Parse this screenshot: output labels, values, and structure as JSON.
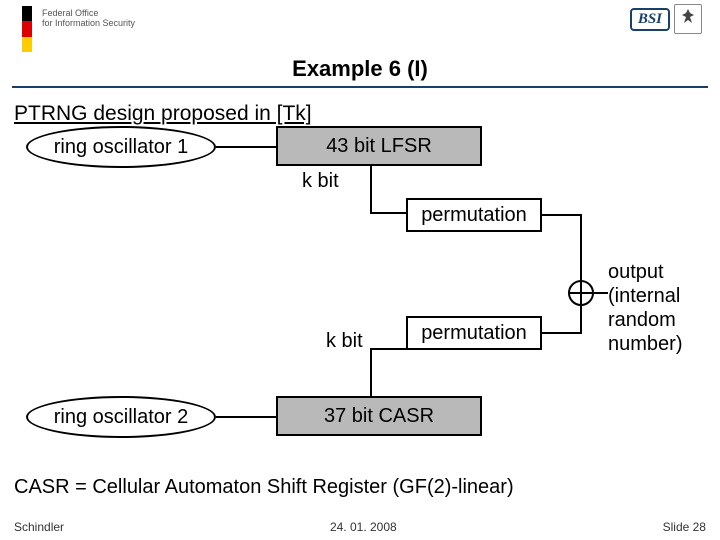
{
  "header": {
    "agency_line1": "Federal Office",
    "agency_line2": "for Information Security",
    "bsi": "BSI"
  },
  "title": "Example 6 (I)",
  "subtitle": "PTRNG design proposed in [Tk]",
  "diagram": {
    "osc1": "ring oscillator 1",
    "osc2": "ring oscillator 2",
    "lfsr": "43 bit LFSR",
    "casr": "37 bit CASR",
    "kbit_top": "k bit",
    "kbit_bot": "k bit",
    "perm_top": "permutation",
    "perm_bot": "permutation",
    "output_l1": "output",
    "output_l2": "(internal",
    "output_l3": "random",
    "output_l4": "number)"
  },
  "footnote": "CASR = Cellular Automaton Shift Register (GF(2)-linear)",
  "footer": {
    "author": "Schindler",
    "date": "24. 01. 2008",
    "slide": "Slide 28"
  }
}
